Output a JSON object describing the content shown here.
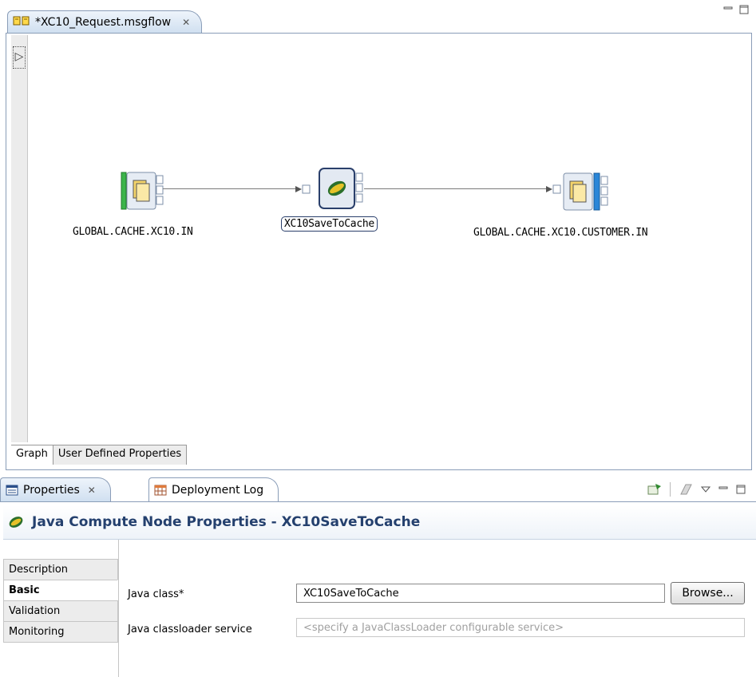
{
  "editor": {
    "tab_title": "*XC10_Request.msgflow",
    "close_glyph": "✕",
    "graph_tabs": [
      "Graph",
      "User Defined Properties"
    ]
  },
  "flow": {
    "nodes": [
      {
        "label": "GLOBAL.CACHE.XC10.IN",
        "type": "mq-input"
      },
      {
        "label": "XC10SaveToCache",
        "type": "java-compute"
      },
      {
        "label": "GLOBAL.CACHE.XC10.CUSTOMER.IN",
        "type": "mq-output"
      }
    ]
  },
  "properties": {
    "tabs": [
      "Properties",
      "Deployment Log"
    ],
    "header_title": "Java Compute Node Properties - XC10SaveToCache",
    "side_tabs": [
      "Description",
      "Basic",
      "Validation",
      "Monitoring"
    ],
    "active_side_tab": "Basic",
    "fields": {
      "java_class_label": "Java class*",
      "java_class_value": "XC10SaveToCache",
      "browse_label": "Browse...",
      "classloader_label": "Java classloader service",
      "classloader_placeholder": "<specify a JavaClassLoader configurable service>"
    }
  },
  "colors": {
    "accent_blue": "#24406e",
    "input_node_bar": "#3cb44b",
    "output_node_bar": "#2a86d8",
    "java_node_border": "#2a3f6b"
  }
}
